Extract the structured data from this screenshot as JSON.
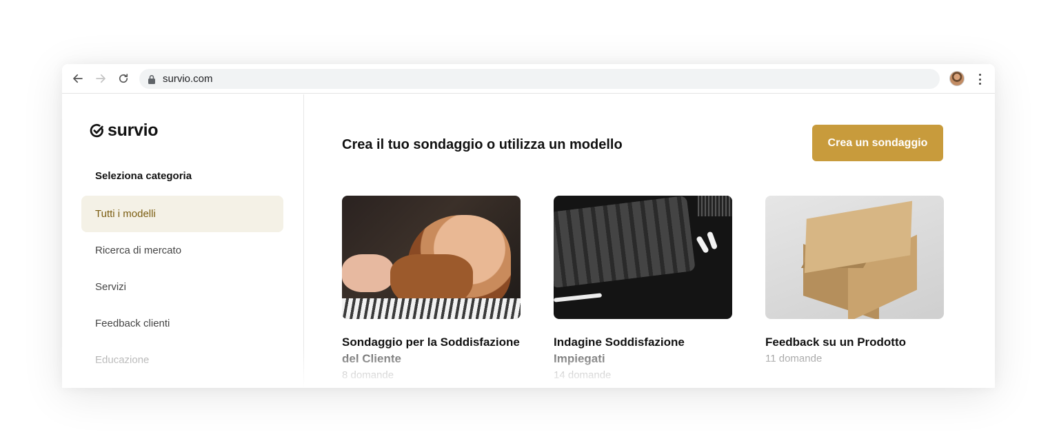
{
  "browser": {
    "url": "survio.com",
    "icons": [
      "back-icon",
      "forward-icon",
      "reload-icon",
      "lock-icon",
      "profile-avatar",
      "more-vert-icon"
    ]
  },
  "sidebar": {
    "logo_text": "survio",
    "heading": "Seleziona categoria",
    "items": [
      {
        "label": "Tutti i modelli",
        "active": true
      },
      {
        "label": "Ricerca di mercato"
      },
      {
        "label": "Servizi"
      },
      {
        "label": "Feedback clienti"
      },
      {
        "label": "Educazione"
      }
    ]
  },
  "main": {
    "title": "Crea il tuo sondaggio o utilizza un modello",
    "create_button": "Crea un sondaggio",
    "cards": [
      {
        "title": "Sondaggio per la Soddisfazione",
        "title_line2": "del Cliente",
        "count": "8 domande",
        "image": "barber-photo"
      },
      {
        "title": "Indagine Soddisfazione",
        "title_line2": "Impiegati",
        "count": "14 domande",
        "image": "keyboard-photo"
      },
      {
        "title": "Feedback su un Prodotto",
        "title_line2": "",
        "count": "11 domande",
        "image": "cardboard-box-photo"
      }
    ]
  },
  "colors": {
    "accent": "#c89b3c",
    "active_bg": "#f4f1e6",
    "active_text": "#7a5c10"
  }
}
